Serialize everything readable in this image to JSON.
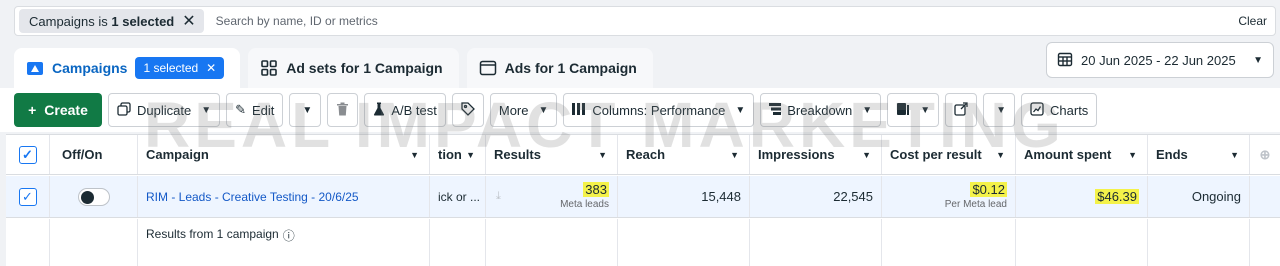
{
  "filter": {
    "chip_prefix": "Campaigns is ",
    "chip_value": "1 selected",
    "search_placeholder": "Search by name, ID or metrics",
    "clear_label": "Clear"
  },
  "tabs": [
    {
      "label": "Campaigns",
      "badge": "1 selected",
      "icon": "folder-icon"
    },
    {
      "label": "Ad sets for 1 Campaign",
      "icon": "grid-icon"
    },
    {
      "label": "Ads for 1 Campaign",
      "icon": "ad-icon"
    }
  ],
  "date_range": "20 Jun 2025 - 22 Jun 2025",
  "toolbar": {
    "create": "Create",
    "duplicate": "Duplicate",
    "edit": "Edit",
    "ab_test": "A/B test",
    "more": "More",
    "columns": "Columns: Performance",
    "breakdown": "Breakdown",
    "charts": "Charts"
  },
  "watermark": "REAL IMPACT MARKETING",
  "table": {
    "headers": [
      "Off/On",
      "Campaign",
      "tion",
      "Results",
      "Reach",
      "Impressions",
      "Cost per result",
      "Amount spent",
      "Ends"
    ],
    "row": {
      "campaign": "RIM - Leads - Creative Testing - 20/6/25",
      "delivery": "ick or ...",
      "results": "383",
      "results_sub": "Meta leads",
      "reach": "15,448",
      "impressions": "22,545",
      "cost_per_result": "$0.12",
      "cost_sub": "Per Meta lead",
      "amount_spent": "$46.39",
      "ends": "Ongoing"
    },
    "summary": "Results from 1 campaign"
  },
  "colors": {
    "accent": "#1877f2",
    "create": "#117a45",
    "highlight": "#f4f24a"
  }
}
